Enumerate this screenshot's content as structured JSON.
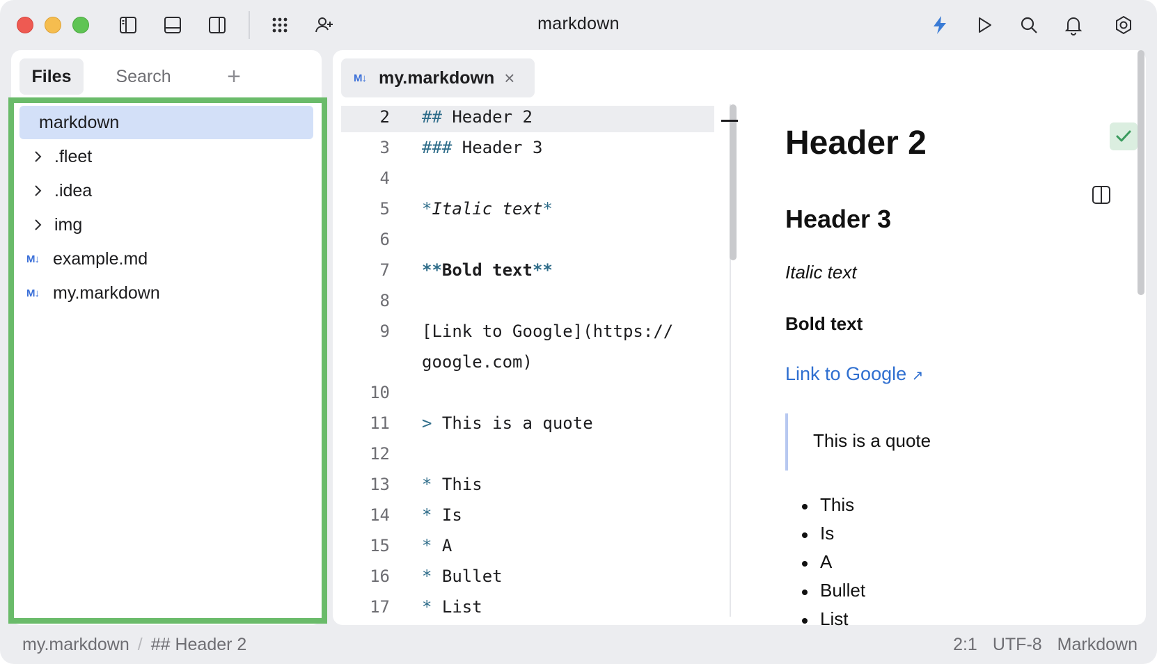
{
  "window": {
    "title": "markdown"
  },
  "toolbar": {
    "icons": [
      "left-panel-icon",
      "bottom-panel-icon",
      "right-panel-icon",
      "apps-grid-icon",
      "add-user-icon",
      "lightning-icon",
      "run-icon",
      "search-icon",
      "bell-icon",
      "settings-icon"
    ],
    "accent_color": "#3a7bd5"
  },
  "sidebar": {
    "tabs": {
      "files": "Files",
      "search": "Search",
      "add": "+"
    },
    "tree": [
      {
        "label": "markdown",
        "type": "root",
        "selected": true
      },
      {
        "label": ".fleet",
        "type": "folder"
      },
      {
        "label": ".idea",
        "type": "folder"
      },
      {
        "label": "img",
        "type": "folder"
      },
      {
        "label": "example.md",
        "type": "markdown-file"
      },
      {
        "label": "my.markdown",
        "type": "markdown-file"
      }
    ],
    "highlight_color": "#6abb6a"
  },
  "editor": {
    "tab": {
      "icon": "M↓",
      "label": "my.markdown",
      "close": "×"
    },
    "file_icon": "M↓",
    "lines": [
      {
        "num": "2",
        "text": "## Header 2"
      },
      {
        "num": "3",
        "text": "### Header 3"
      },
      {
        "num": "4",
        "text": ""
      },
      {
        "num": "5",
        "text": "*Italic text*"
      },
      {
        "num": "6",
        "text": ""
      },
      {
        "num": "7",
        "text": "**Bold text**"
      },
      {
        "num": "8",
        "text": ""
      },
      {
        "num": "9",
        "text": "[Link to Google](https://"
      },
      {
        "num": "",
        "text": "google.com)"
      },
      {
        "num": "10",
        "text": ""
      },
      {
        "num": "11",
        "text": "> This is a quote"
      },
      {
        "num": "12",
        "text": ""
      },
      {
        "num": "13",
        "text": "* This"
      },
      {
        "num": "14",
        "text": "* Is"
      },
      {
        "num": "15",
        "text": "* A"
      },
      {
        "num": "16",
        "text": "* Bullet"
      },
      {
        "num": "17",
        "text": "* List"
      }
    ]
  },
  "preview": {
    "h2": "Header 2",
    "h3": "Header 3",
    "italic": "Italic text",
    "bold": "Bold text",
    "link": "Link to Google",
    "link_arrow": "↗",
    "quote": "This is a quote",
    "list": [
      "This",
      "Is",
      "A",
      "Bullet",
      "List"
    ]
  },
  "status": {
    "breadcrumb": [
      "my.markdown",
      "## Header 2"
    ],
    "separator": "/",
    "position": "2:1",
    "encoding": "UTF-8",
    "language": "Markdown"
  }
}
